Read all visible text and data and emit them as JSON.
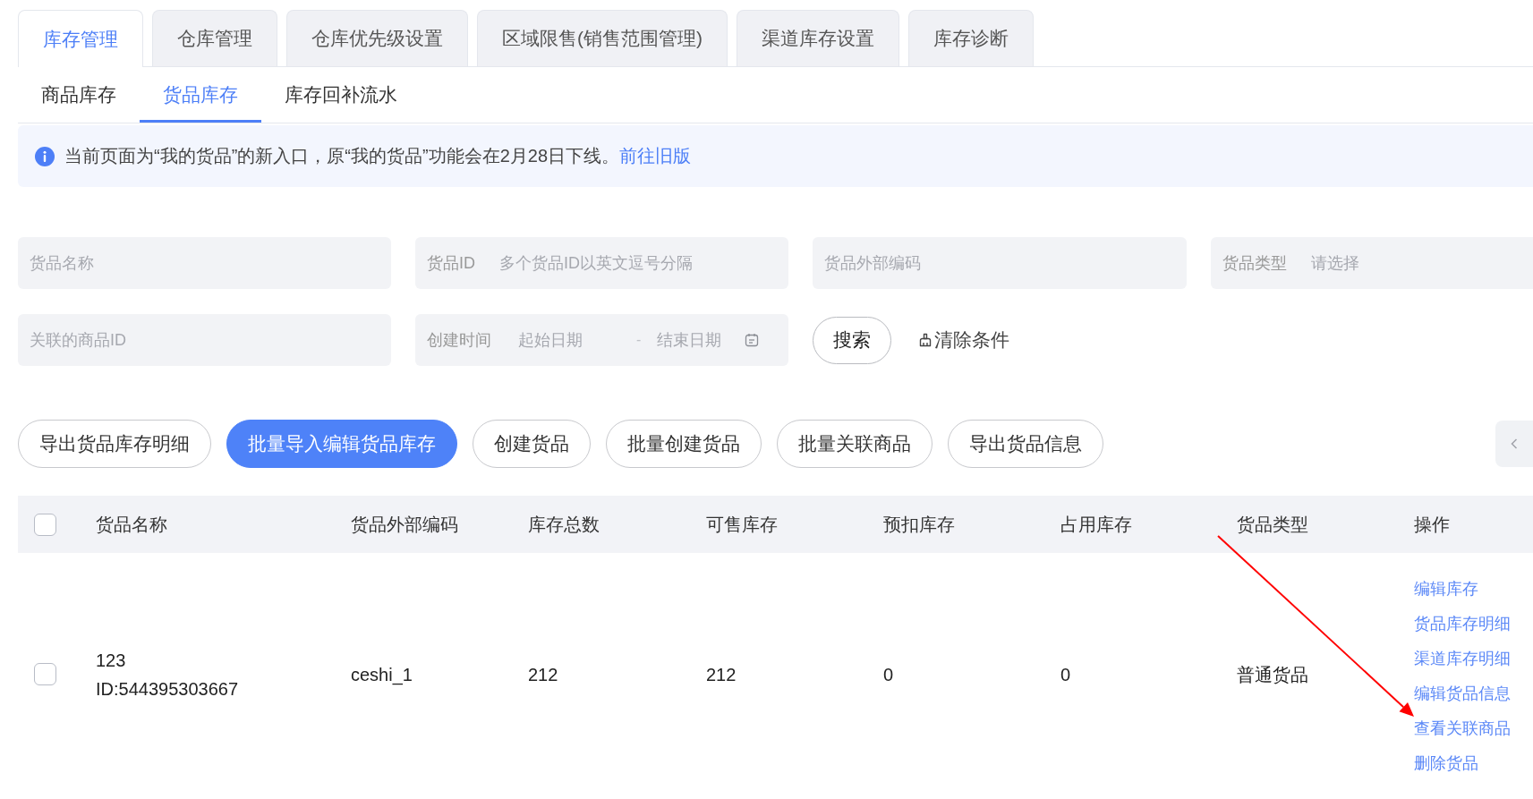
{
  "top_tabs": [
    {
      "label": "库存管理",
      "selected": true
    },
    {
      "label": "仓库管理",
      "selected": false
    },
    {
      "label": "仓库优先级设置",
      "selected": false
    },
    {
      "label": "区域限售(销售范围管理)",
      "selected": false
    },
    {
      "label": "渠道库存设置",
      "selected": false
    },
    {
      "label": "库存诊断",
      "selected": false
    }
  ],
  "sub_tabs": [
    {
      "label": "商品库存",
      "selected": false
    },
    {
      "label": "货品库存",
      "selected": true
    },
    {
      "label": "库存回补流水",
      "selected": false
    }
  ],
  "notice": {
    "text": "当前页面为“我的货品”的新入口，原“我的货品”功能会在2月28日下线。",
    "link": "前往旧版"
  },
  "filters": [
    {
      "kind": "text",
      "placeholder": "货品名称"
    },
    {
      "kind": "text",
      "label": "货品ID",
      "placeholder": "多个货品ID以英文逗号分隔"
    },
    {
      "kind": "text",
      "placeholder": "货品外部编码"
    },
    {
      "kind": "select",
      "label": "货品类型",
      "placeholder": "请选择"
    },
    {
      "kind": "text",
      "placeholder": "关联的商品ID"
    },
    {
      "kind": "date_range",
      "label": "创建时间",
      "start_placeholder": "起始日期",
      "separator": "-",
      "end_placeholder": "结束日期"
    }
  ],
  "search_button": "搜索",
  "clear_button": "清除条件",
  "action_buttons": [
    {
      "label": "导出货品库存明细",
      "primary": false
    },
    {
      "label": "批量导入编辑货品库存",
      "primary": true
    },
    {
      "label": "创建货品",
      "primary": false
    },
    {
      "label": "批量创建货品",
      "primary": false
    },
    {
      "label": "批量关联商品",
      "primary": false
    },
    {
      "label": "导出货品信息",
      "primary": false
    }
  ],
  "table": {
    "select_all_checked": false,
    "columns": [
      "货品名称",
      "货品外部编码",
      "库存总数",
      "可售库存",
      "预扣库存",
      "占用库存",
      "货品类型",
      "操作"
    ],
    "rows": [
      {
        "checked": false,
        "cells": [
          {
            "kind": "stacked",
            "texts": [
              "123",
              "ID:544395303667"
            ]
          },
          {
            "kind": "text",
            "text": "ceshi_1"
          },
          {
            "kind": "text",
            "text": "212"
          },
          {
            "kind": "text",
            "text": "212"
          },
          {
            "kind": "text",
            "text": "0"
          },
          {
            "kind": "text",
            "text": "0"
          },
          {
            "kind": "text",
            "text": "普通货品"
          },
          {
            "kind": "links",
            "texts": [
              "编辑库存",
              "货品库存明细",
              "渠道库存明细",
              "编辑货品信息",
              "查看关联商品",
              "删除货品"
            ]
          }
        ]
      }
    ]
  }
}
